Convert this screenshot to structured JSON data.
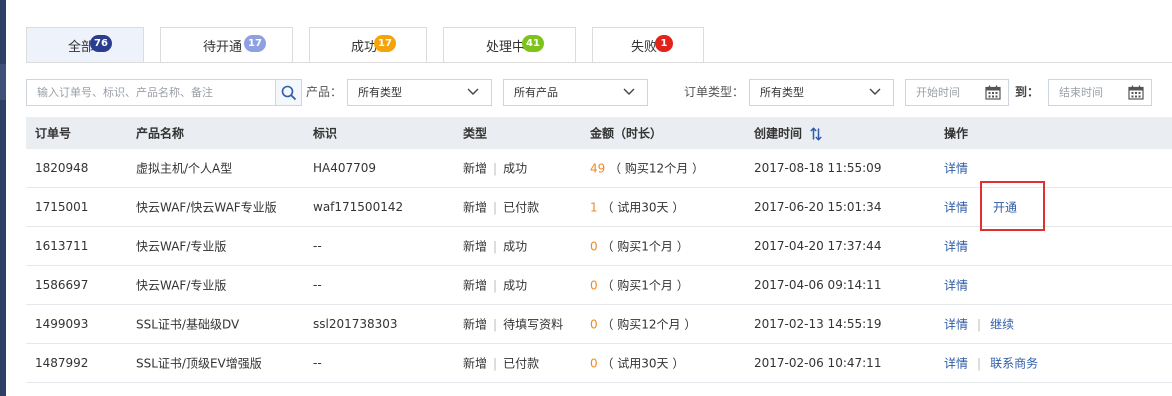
{
  "tabs": [
    {
      "label": "全部",
      "count": "76",
      "badge_color": "#2b3d8f",
      "active": true
    },
    {
      "label": "待开通",
      "count": "17",
      "badge_color": "#8ea0e0",
      "active": false
    },
    {
      "label": "成功",
      "count": "17",
      "badge_color": "#f5a30a",
      "active": false
    },
    {
      "label": "处理中",
      "count": "41",
      "badge_color": "#7ec21c",
      "active": false
    },
    {
      "label": "失败",
      "count": "1",
      "badge_color": "#e2231a",
      "active": false
    }
  ],
  "filters": {
    "search_placeholder": "输入订单号、标识、产品名称、备注",
    "product_label": "产品：",
    "product_type_value": "所有类型",
    "product_value": "所有产品",
    "order_type_label": "订单类型：",
    "order_type_value": "所有类型",
    "start_placeholder": "开始时间",
    "to_label": "到：",
    "end_placeholder": "结束时间"
  },
  "table": {
    "headers": {
      "order_no": "订单号",
      "product_name": "产品名称",
      "identifier": "标识",
      "type": "类型",
      "amount": "金额（时长）",
      "created": "创建时间",
      "actions": "操作"
    },
    "rows": [
      {
        "order_no": "1820948",
        "product_name": "虚拟主机/个人A型",
        "identifier": "HA407709",
        "type": "新增",
        "status": "成功",
        "amount": "49",
        "duration": "（ 购买12个月 ）",
        "created": "2017-08-18 11:55:09",
        "action1": "详情",
        "action2": ""
      },
      {
        "order_no": "1715001",
        "product_name": "快云WAF/快云WAF专业版",
        "identifier": "waf171500142",
        "type": "新增",
        "status": "已付款",
        "amount": "1",
        "duration": "（ 试用30天 ）",
        "created": "2017-06-20 15:01:34",
        "action1": "详情",
        "action2": "开通"
      },
      {
        "order_no": "1613711",
        "product_name": "快云WAF/专业版",
        "identifier": "--",
        "type": "新增",
        "status": "成功",
        "amount": "0",
        "duration": "（ 购买1个月 ）",
        "created": "2017-04-20 17:37:44",
        "action1": "详情",
        "action2": ""
      },
      {
        "order_no": "1586697",
        "product_name": "快云WAF/专业版",
        "identifier": "--",
        "type": "新增",
        "status": "成功",
        "amount": "0",
        "duration": "（ 购买1个月 ）",
        "created": "2017-04-06 09:14:11",
        "action1": "详情",
        "action2": ""
      },
      {
        "order_no": "1499093",
        "product_name": "SSL证书/基础级DV",
        "identifier": "ssl201738303",
        "type": "新增",
        "status": "待填写资料",
        "amount": "0",
        "duration": "（ 购买12个月 ）",
        "created": "2017-02-13 14:55:19",
        "action1": "详情",
        "action2": "继续"
      },
      {
        "order_no": "1487992",
        "product_name": "SSL证书/顶级EV增强版",
        "identifier": "--",
        "type": "新增",
        "status": "已付款",
        "amount": "0",
        "duration": "（ 试用30天 ）",
        "created": "2017-02-06 10:47:11",
        "action1": "详情",
        "action2": "联系商务"
      }
    ]
  },
  "icons": {
    "search": "search-icon",
    "chevron": "chevron-down-icon",
    "calendar": "calendar-icon",
    "sort": "sort-icon"
  }
}
